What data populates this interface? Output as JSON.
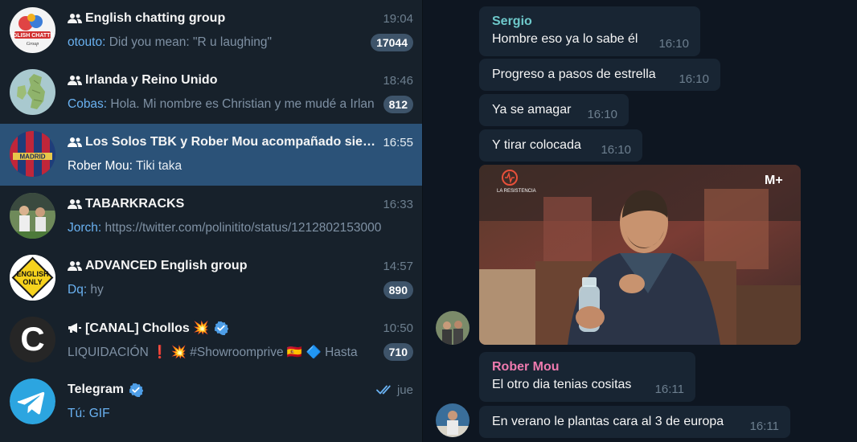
{
  "chats": [
    {
      "title": "English chatting group",
      "time": "19:04",
      "sender": "otouto:",
      "preview": " Did you mean: \"R u laughing\"",
      "badge": "17044"
    },
    {
      "title": "Irlanda y Reino Unido",
      "time": "18:46",
      "sender": "Cobas:",
      "preview": " Hola. Mi nombre es Christian y me mudé a Irlan",
      "badge": "812"
    },
    {
      "title": "Los Solos TBK y Rober Mou acompañado siempre",
      "time": "16:55",
      "sender": "Rober Mou:",
      "preview": " Tiki taka"
    },
    {
      "title": "TABARKRACKS",
      "time": "16:33",
      "sender": "Jorch:",
      "preview": " https://twitter.com/polinitito/status/1212802153000"
    },
    {
      "title": "ADVANCED English group",
      "time": "14:57",
      "sender": "Dq:",
      "preview": " hy",
      "badge": "890",
      "avatar_text": "ENGLISH ONLY"
    },
    {
      "title": "[CANAL] Chollos 💥",
      "time": "10:50",
      "preview": "LIQUIDACIÓN ❗ 💥 #Showroomprive 🇪🇸  🔷 Hasta",
      "badge": "710",
      "avatar_text": "C"
    },
    {
      "title": "Telegram",
      "time": "jue",
      "sender": "Tú:",
      "preview": " GIF"
    }
  ],
  "messages": [
    {
      "author": "Sergio",
      "author_color": "#6ec9cb",
      "text": "Hombre eso ya lo sabe él",
      "time": "16:10"
    },
    {
      "text": "Progreso a pasos de estrella",
      "time": "16:10"
    },
    {
      "text": "Ya se amagar",
      "time": "16:10"
    },
    {
      "text": "Y tirar colocada",
      "time": "16:10"
    },
    {
      "author": "Rober Mou",
      "author_color": "#ee7aae",
      "text": "El otro dia tenias cositas",
      "time": "16:11"
    },
    {
      "text": "En verano le plantas cara al 3 de europa",
      "time": "16:11"
    }
  ],
  "gif": {
    "channel_logo": "LA RESISTENCIA",
    "network_logo": "M+"
  },
  "colors": {
    "accent": "#2b5278",
    "link": "#6ab2f2",
    "badge": "#3e546a",
    "bubble": "#182533"
  },
  "icons": {
    "group": "group-icon",
    "channel": "megaphone-icon",
    "verified": "verified-icon",
    "read": "double-check-icon"
  }
}
